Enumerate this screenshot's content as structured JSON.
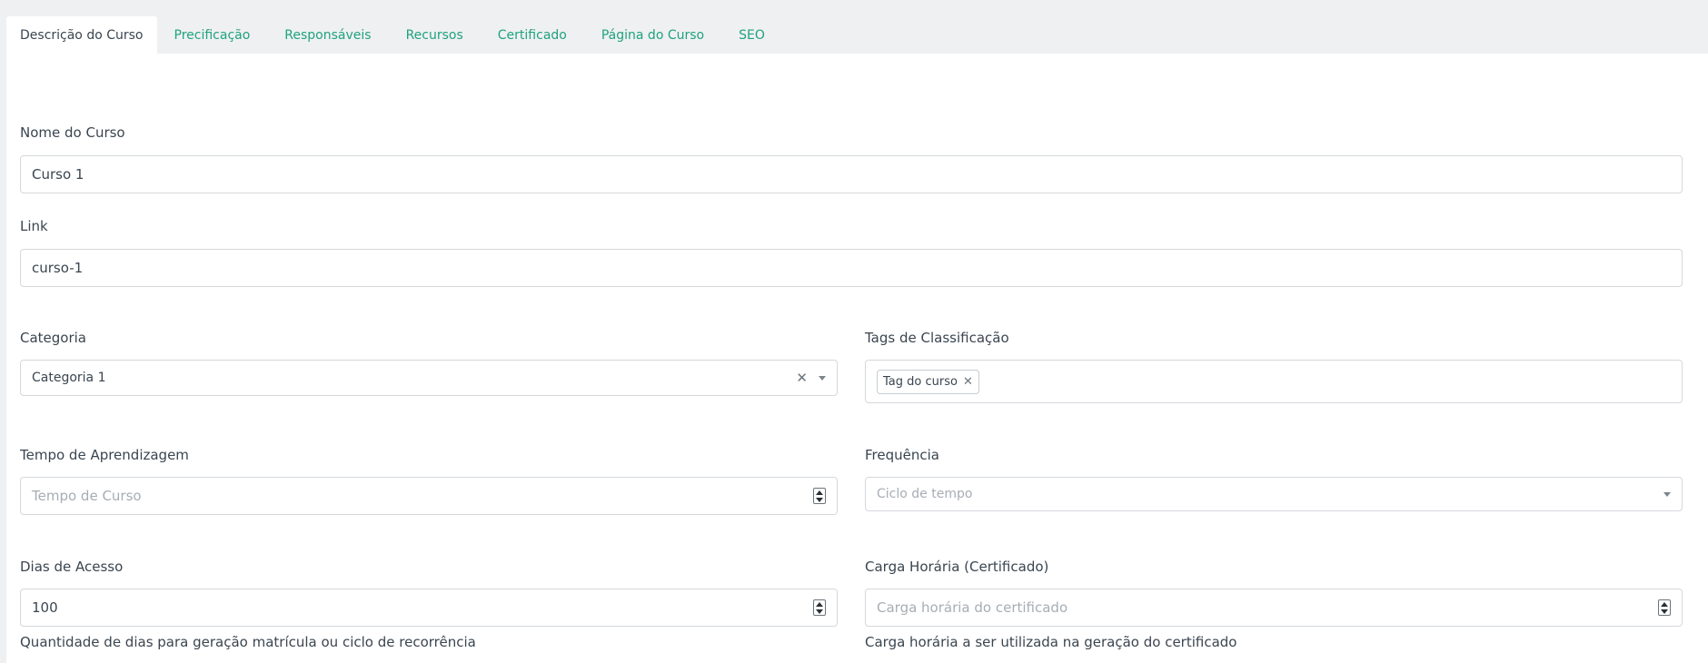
{
  "tabs": [
    {
      "label": "Descrição do Curso",
      "active": true
    },
    {
      "label": "Precificação"
    },
    {
      "label": "Responsáveis"
    },
    {
      "label": "Recursos"
    },
    {
      "label": "Certificado"
    },
    {
      "label": "Página do Curso"
    },
    {
      "label": "SEO"
    }
  ],
  "form": {
    "course_name": {
      "label": "Nome do Curso",
      "value": "Curso 1"
    },
    "link": {
      "label": "Link",
      "value": "curso-1"
    },
    "category": {
      "label": "Categoria",
      "value": "Categoria 1"
    },
    "tags": {
      "label": "Tags de Classificação",
      "items": [
        "Tag do curso"
      ]
    },
    "learning_time": {
      "label": "Tempo de Aprendizagem",
      "placeholder": "Tempo de Curso"
    },
    "frequency": {
      "label": "Frequência",
      "placeholder": "Ciclo de tempo"
    },
    "access_days": {
      "label": "Dias de Acesso",
      "value": "100",
      "help": "Quantidade de dias para geração matrícula ou ciclo de recorrência"
    },
    "workload": {
      "label": "Carga Horária (Certificado)",
      "placeholder": "Carga horária do certificado",
      "help": "Carga horária a ser utilizada na geração do certificado"
    }
  },
  "colors": {
    "accent": "#1fa37a",
    "background": "#eff0f2",
    "panel": "#ffffff",
    "border": "#d5d8dc"
  }
}
